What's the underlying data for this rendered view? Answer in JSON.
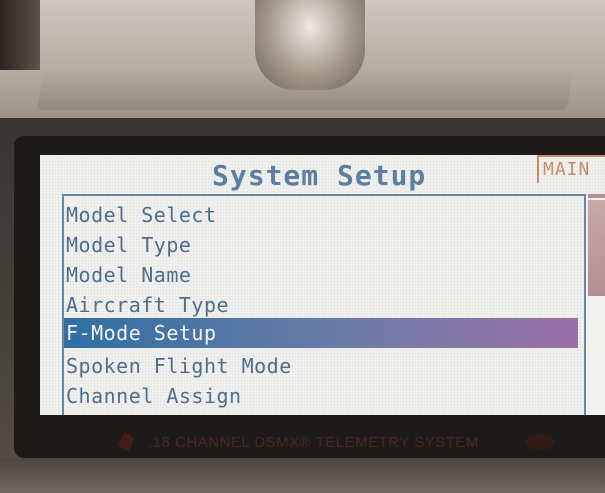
{
  "screen": {
    "title": "System Setup",
    "main_tab": "MAIN"
  },
  "menu": {
    "items": [
      {
        "label": "Model Select",
        "selected": false
      },
      {
        "label": "Model Type",
        "selected": false
      },
      {
        "label": "Model Name",
        "selected": false
      },
      {
        "label": "Aircraft Type",
        "selected": false
      },
      {
        "label": "F-Mode Setup",
        "selected": true
      },
      {
        "label": "Spoken Flight Mode",
        "selected": false
      },
      {
        "label": "Channel Assign",
        "selected": false
      }
    ]
  },
  "device": {
    "bezel_text": ".18 CHANNEL DSMX® TELEMETRY SYSTEM"
  },
  "colors": {
    "text": "#4e6e8b",
    "highlight_start": "#2f6fa2",
    "highlight_end": "#9a70a8",
    "tab": "#c88a6a"
  }
}
